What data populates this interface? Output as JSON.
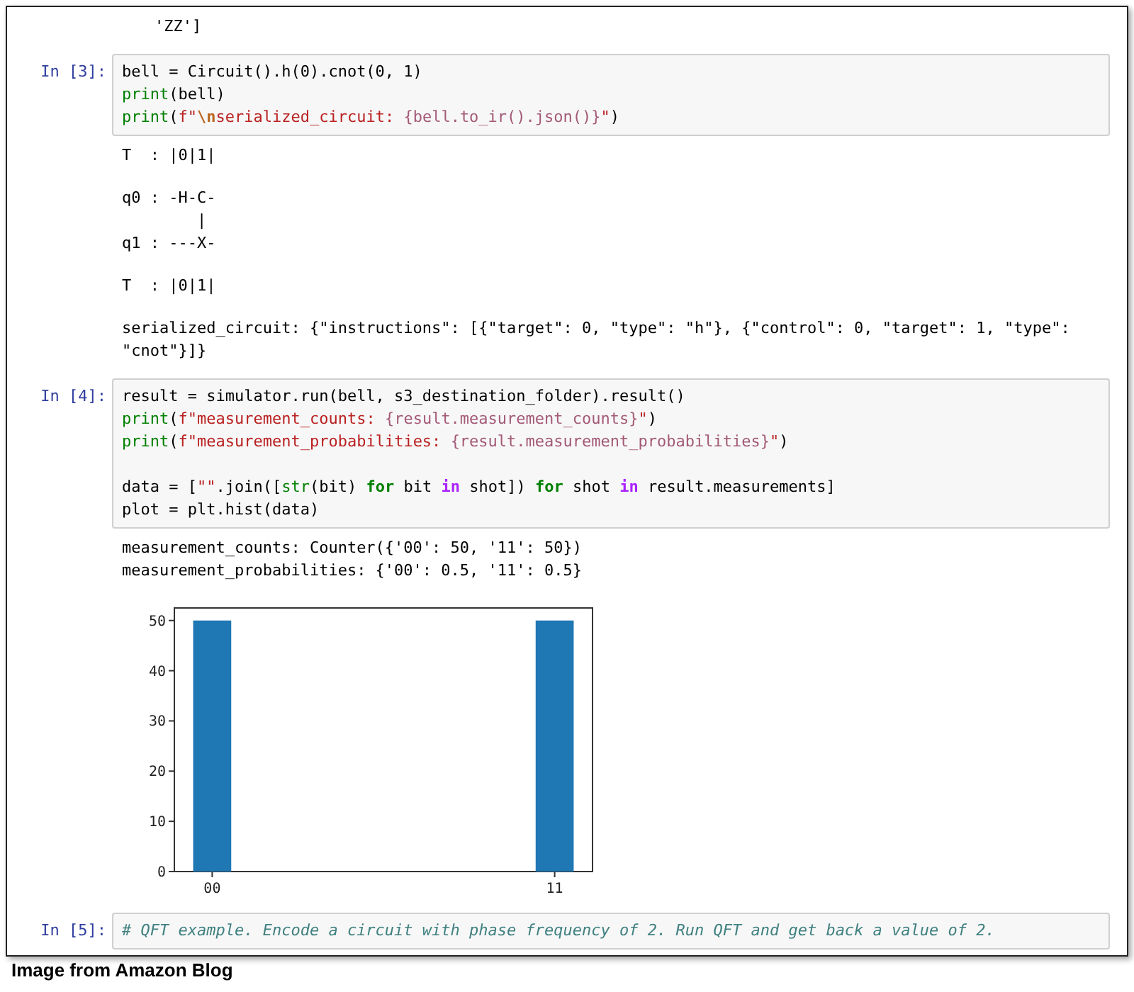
{
  "top_output": "'ZZ']",
  "cells": [
    {
      "prompt": "In [3]:",
      "code": [
        [
          [
            {
              "text": "bell = Circuit().h(0).cnot(0, 1)",
              "kind": "plain"
            }
          ],
          [
            {
              "text": "print",
              "kind": "builtin"
            },
            {
              "text": "(bell)",
              "kind": "plain"
            }
          ],
          [
            {
              "text": "print",
              "kind": "builtin"
            },
            {
              "text": "(",
              "kind": "plain"
            },
            {
              "text": "f\"",
              "kind": "string"
            },
            {
              "text": "\\n",
              "kind": "escape"
            },
            {
              "text": "serialized_circuit: ",
              "kind": "string"
            },
            {
              "text": "{bell.to_ir().json()}",
              "kind": "interp"
            },
            {
              "text": "\"",
              "kind": "string"
            },
            {
              "text": ")",
              "kind": "plain"
            }
          ]
        ]
      ],
      "outputs": [
        {
          "kind": "text",
          "lines": [
            "T  : |0|1|"
          ]
        },
        {
          "kind": "text",
          "lines": [
            "q0 : -H-C-",
            "        |",
            "q1 : ---X-"
          ]
        },
        {
          "kind": "text",
          "lines": [
            "T  : |0|1|"
          ]
        },
        {
          "kind": "text",
          "lines": [
            "serialized_circuit: {\"instructions\": [{\"target\": 0, \"type\": \"h\"}, {\"control\": 0, \"target\": 1, \"type\":",
            "\"cnot\"}]}"
          ]
        }
      ]
    },
    {
      "prompt": "In [4]:",
      "code": [
        [
          [
            {
              "text": "result = simulator.run(bell, s3_destination_folder).result()",
              "kind": "plain"
            }
          ],
          [
            {
              "text": "print",
              "kind": "builtin"
            },
            {
              "text": "(",
              "kind": "plain"
            },
            {
              "text": "f\"measurement_counts: ",
              "kind": "string"
            },
            {
              "text": "{result.measurement_counts}",
              "kind": "interp"
            },
            {
              "text": "\"",
              "kind": "string"
            },
            {
              "text": ")",
              "kind": "plain"
            }
          ],
          [
            {
              "text": "print",
              "kind": "builtin"
            },
            {
              "text": "(",
              "kind": "plain"
            },
            {
              "text": "f\"measurement_probabilities: ",
              "kind": "string"
            },
            {
              "text": "{result.measurement_probabilities}",
              "kind": "interp"
            },
            {
              "text": "\"",
              "kind": "string"
            },
            {
              "text": ")",
              "kind": "plain"
            }
          ]
        ],
        [
          [
            {
              "text": "data = [",
              "kind": "plain"
            },
            {
              "text": "\"\"",
              "kind": "string"
            },
            {
              "text": ".join([",
              "kind": "plain"
            },
            {
              "text": "str",
              "kind": "builtin"
            },
            {
              "text": "(bit) ",
              "kind": "plain"
            },
            {
              "text": "for",
              "kind": "keyword"
            },
            {
              "text": " bit ",
              "kind": "plain"
            },
            {
              "text": "in",
              "kind": "opword"
            },
            {
              "text": " shot]) ",
              "kind": "plain"
            },
            {
              "text": "for",
              "kind": "keyword"
            },
            {
              "text": " shot ",
              "kind": "plain"
            },
            {
              "text": "in",
              "kind": "opword"
            },
            {
              "text": " result.measurements]",
              "kind": "plain"
            }
          ],
          [
            {
              "text": "plot = plt.hist(data)",
              "kind": "plain"
            }
          ]
        ]
      ],
      "outputs": [
        {
          "kind": "text",
          "lines": [
            "measurement_counts: Counter({'00': 50, '11': 50})",
            "measurement_probabilities: {'00': 0.5, '11': 0.5}"
          ]
        },
        {
          "kind": "chart",
          "chart_data": {
            "type": "bar",
            "categories": [
              "00",
              null,
              null,
              null,
              null,
              null,
              null,
              null,
              null,
              "11"
            ],
            "values": [
              50,
              0,
              0,
              0,
              0,
              0,
              0,
              0,
              0,
              50
            ],
            "ylim": [
              0,
              52.5
            ],
            "yticks": [
              0,
              10,
              20,
              30,
              40,
              50
            ]
          }
        }
      ]
    },
    {
      "prompt": "In [5]:",
      "code": [
        [
          [
            {
              "text": "# QFT example. Encode a circuit with phase frequency of 2. Run QFT and get back a value of 2.",
              "kind": "comment"
            }
          ]
        ]
      ]
    }
  ],
  "caption": "Image from Amazon Blog"
}
